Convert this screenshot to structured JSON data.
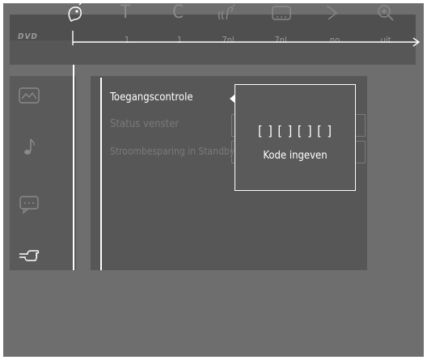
{
  "toolbar": {
    "icons": [
      {
        "name": "parental-lock-icon"
      },
      {
        "name": "title-icon",
        "glyph": "T"
      },
      {
        "name": "chapter-icon",
        "glyph": "C"
      },
      {
        "name": "audio-language-icon"
      },
      {
        "name": "subtitle-icon"
      },
      {
        "name": "angle-icon"
      },
      {
        "name": "zoom-icon"
      }
    ],
    "values": [
      "1",
      "1",
      "7nl",
      "7nl",
      "no",
      "uit"
    ],
    "logo": "DVD"
  },
  "sidebar": {
    "items": [
      {
        "name": "picture-settings-icon"
      },
      {
        "name": "sound-settings-icon"
      },
      {
        "name": "language-settings-icon"
      },
      {
        "name": "features-settings-icon"
      }
    ]
  },
  "menu": {
    "items": [
      {
        "label": "Toegangscontrole",
        "state": "active"
      },
      {
        "label": "Status venster",
        "state": "dim"
      },
      {
        "label": "Stroombesparing in Standby",
        "state": "dim"
      }
    ]
  },
  "dialog": {
    "code": "[ ] [ ] [ ] [ ]",
    "hint": "Kode ingeven"
  }
}
